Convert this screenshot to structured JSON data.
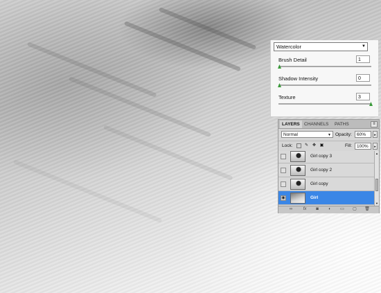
{
  "filter": {
    "selected": "Watercolor",
    "params": [
      {
        "label": "Brush Detail",
        "value": "1",
        "slider": 0.0
      },
      {
        "label": "Shadow Intensity",
        "value": "0",
        "slider": 0.0
      },
      {
        "label": "Texture",
        "value": "3",
        "slider": 1.0
      }
    ]
  },
  "layers_panel": {
    "tabs": [
      "LAYERS",
      "CHANNELS",
      "PATHS"
    ],
    "active_tab": "LAYERS",
    "blend_mode": "Normal",
    "opacity_label": "Opacity:",
    "opacity_value": "60%",
    "lock_label": "Lock:",
    "fill_label": "Fill:",
    "fill_value": "100%",
    "layers": [
      {
        "name": "Girl copy 3",
        "visible": false,
        "selected": false
      },
      {
        "name": "Girl copy 2",
        "visible": false,
        "selected": false
      },
      {
        "name": "Girl copy",
        "visible": false,
        "selected": false
      },
      {
        "name": "Girl",
        "visible": true,
        "selected": true
      }
    ],
    "bottom_icons": [
      "link-icon",
      "fx-icon",
      "mask-icon",
      "adjustment-icon",
      "group-icon",
      "new-layer-icon",
      "trash-icon"
    ]
  },
  "colors": {
    "selection": "#3a86e6",
    "slider_thumb": "#3a9b3a"
  }
}
